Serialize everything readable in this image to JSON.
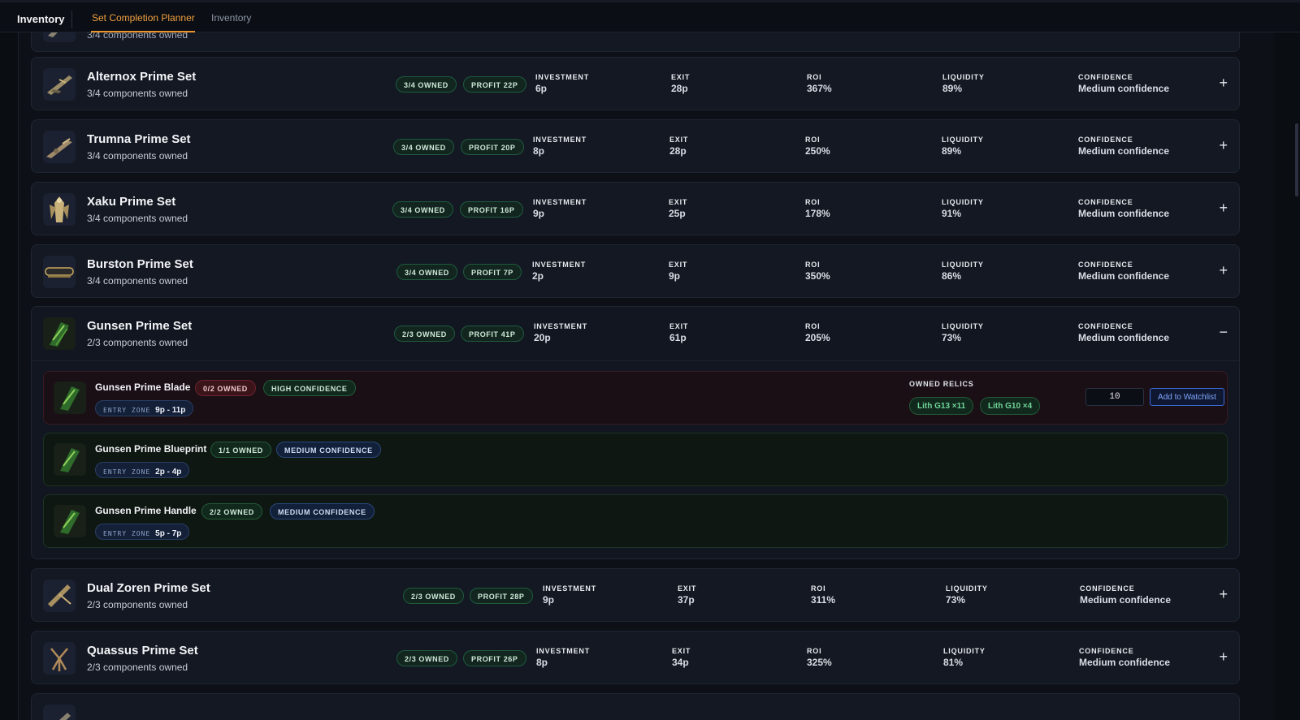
{
  "header": {
    "brand": "Inventory",
    "tabs": [
      {
        "label": "Set Completion Planner",
        "active": true
      },
      {
        "label": "Inventory",
        "active": false
      }
    ],
    "accent_color": "#e8952e"
  },
  "metric_labels": {
    "investment": "INVESTMENT",
    "exit": "EXIT",
    "roi": "ROI",
    "liquidity": "LIQUIDITY",
    "confidence": "CONFIDENCE"
  },
  "sets": [
    {
      "name": "Alternox Prime Set",
      "sub": "3/4 components owned",
      "owned": "3/4 OWNED",
      "profit": "PROFIT 22P",
      "investment": "6p",
      "exit": "28p",
      "roi": "367%",
      "liquidity": "89%",
      "confidence": "Medium confidence",
      "toggle": "+",
      "icon": "weapon-icon"
    },
    {
      "name": "Trumna Prime Set",
      "sub": "3/4 components owned",
      "owned": "3/4 OWNED",
      "profit": "PROFIT 20P",
      "investment": "8p",
      "exit": "28p",
      "roi": "250%",
      "liquidity": "89%",
      "confidence": "Medium confidence",
      "toggle": "+",
      "icon": "weapon-icon"
    },
    {
      "name": "Xaku Prime Set",
      "sub": "3/4 components owned",
      "owned": "3/4 OWNED",
      "profit": "PROFIT 16P",
      "investment": "9p",
      "exit": "25p",
      "roi": "178%",
      "liquidity": "91%",
      "confidence": "Medium confidence",
      "toggle": "+",
      "icon": "warframe-icon"
    },
    {
      "name": "Burston Prime Set",
      "sub": "3/4 components owned",
      "owned": "3/4 OWNED",
      "profit": "PROFIT 7P",
      "investment": "2p",
      "exit": "9p",
      "roi": "350%",
      "liquidity": "86%",
      "confidence": "Medium confidence",
      "toggle": "+",
      "icon": "weapon-icon"
    },
    {
      "name": "Gunsen Prime Set",
      "sub": "2/3 components owned",
      "owned": "2/3 OWNED",
      "profit": "PROFIT 41P",
      "investment": "20p",
      "exit": "61p",
      "roi": "205%",
      "liquidity": "73%",
      "confidence": "Medium confidence",
      "toggle": "−",
      "icon": "weapon-icon"
    },
    {
      "name": "Dual Zoren Prime Set",
      "sub": "2/3 components owned",
      "owned": "2/3 OWNED",
      "profit": "PROFIT 28P",
      "investment": "9p",
      "exit": "37p",
      "roi": "311%",
      "liquidity": "73%",
      "confidence": "Medium confidence",
      "toggle": "+",
      "icon": "weapon-icon"
    },
    {
      "name": "Quassus Prime Set",
      "sub": "2/3 components owned",
      "owned": "2/3 OWNED",
      "profit": "PROFIT 26P",
      "investment": "8p",
      "exit": "34p",
      "roi": "325%",
      "liquidity": "81%",
      "confidence": "Medium confidence",
      "toggle": "+",
      "icon": "weapon-icon"
    }
  ],
  "partial_top_sub": "3/4 components owned",
  "gunsen_parts": [
    {
      "name": "Gunsen Prime Blade",
      "owned": "0/2 OWNED",
      "confidence": "HIGH CONFIDENCE",
      "entry_label": "ENTRY ZONE",
      "entry": "9p - 11p",
      "status_color": "#6e2330"
    },
    {
      "name": "Gunsen Prime Blueprint",
      "owned": "1/1 OWNED",
      "confidence": "MEDIUM CONFIDENCE",
      "entry_label": "ENTRY ZONE",
      "entry": "2p - 4p",
      "status_color": "#245a38"
    },
    {
      "name": "Gunsen Prime Handle",
      "owned": "2/2 OWNED",
      "confidence": "MEDIUM CONFIDENCE",
      "entry_label": "ENTRY ZONE",
      "entry": "5p - 7p",
      "status_color": "#245a38"
    }
  ],
  "relics": {
    "label": "OWNED RELICS",
    "items": [
      "Lith G13 ×11",
      "Lith G10 ×4"
    ]
  },
  "watchlist": {
    "quantity": "10",
    "button_label": "Add to Watchlist"
  }
}
